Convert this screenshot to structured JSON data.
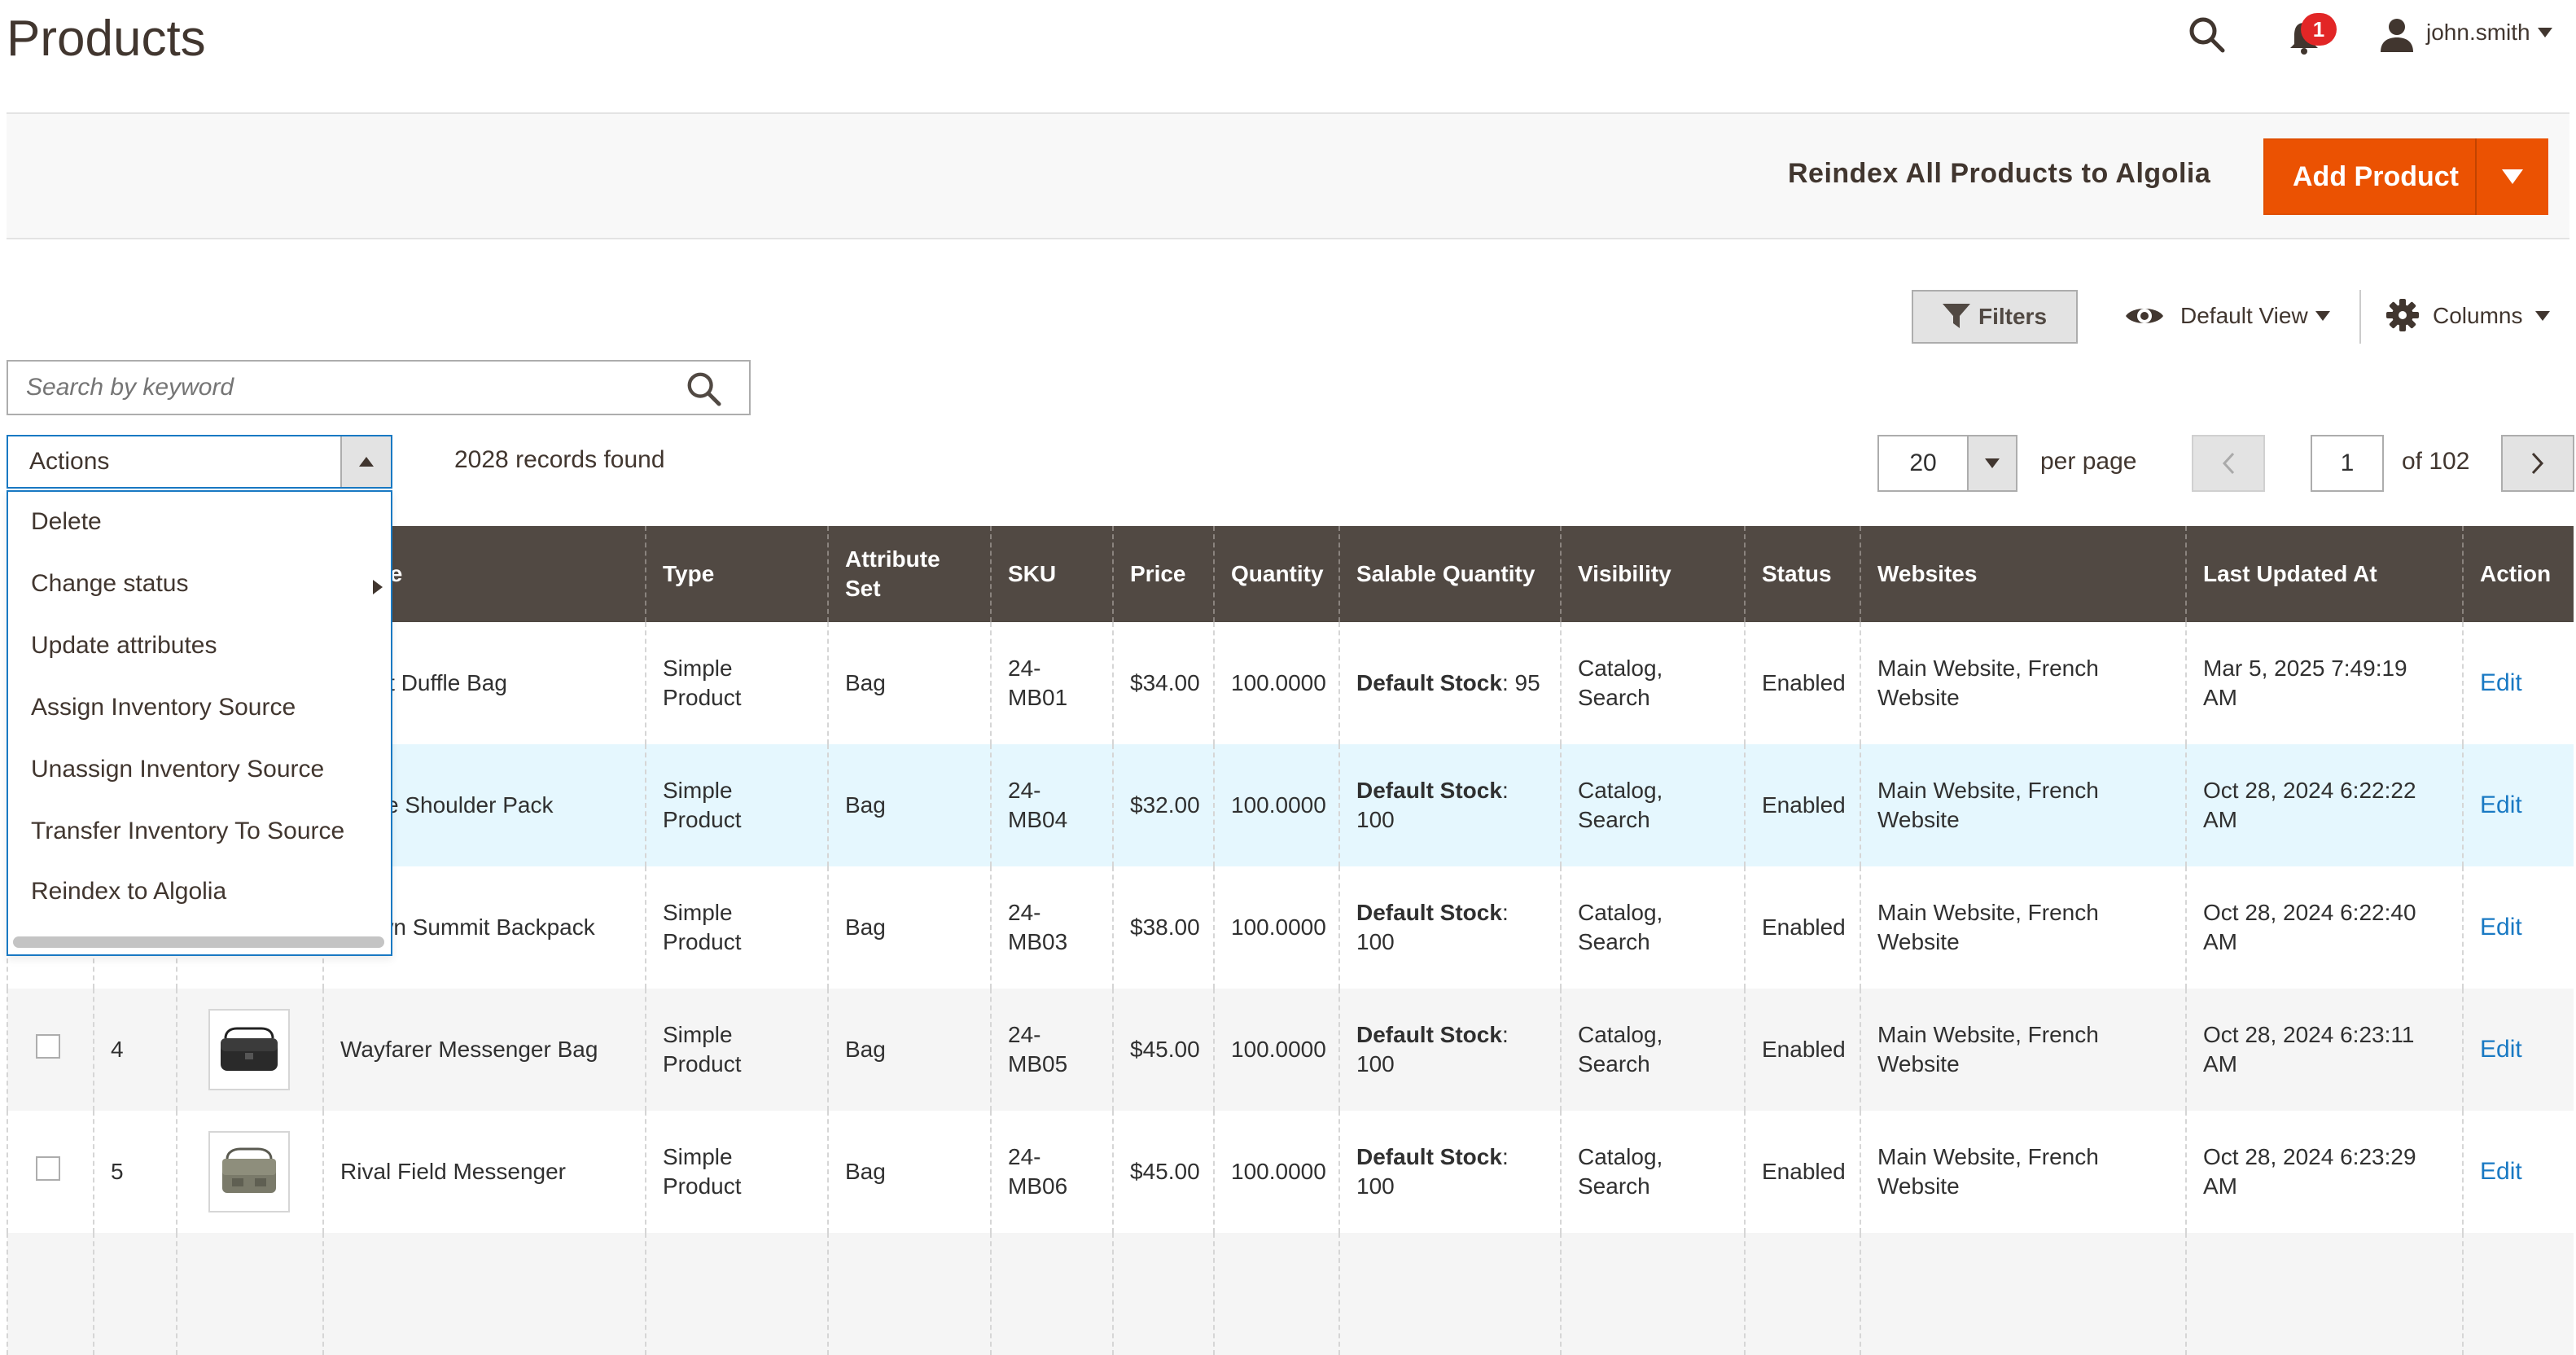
{
  "header": {
    "title": "Products",
    "notification_count": "1",
    "user": "john.smith"
  },
  "action_bar": {
    "reindex_label": "Reindex All Products to Algolia",
    "add_product_label": "Add Product"
  },
  "controls": {
    "filters_label": "Filters",
    "view_label": "Default View",
    "columns_label": "Columns",
    "search_placeholder": "Search by keyword",
    "actions_label": "Actions",
    "records_found": "2028 records found",
    "per_page_value": "20",
    "per_page_label": "per page",
    "current_page": "1",
    "page_total": "of 102"
  },
  "actions_menu": {
    "items": [
      "Delete",
      "Change status",
      "Update attributes",
      "Assign Inventory Source",
      "Unassign Inventory Source",
      "Transfer Inventory To Source",
      "Reindex to Algolia"
    ]
  },
  "table": {
    "headers": {
      "name": "Name",
      "type": "Type",
      "attribute_set_1": "Attribute",
      "attribute_set_2": "Set",
      "sku": "SKU",
      "price": "Price",
      "quantity": "Quantity",
      "salable": "Salable Quantity",
      "visibility": "Visibility",
      "status": "Status",
      "websites": "Websites",
      "updated": "Last Updated At",
      "action": "Action"
    },
    "rows": [
      {
        "id": "",
        "name": "Joust Duffle Bag",
        "type_1": "Simple",
        "type_2": "Product",
        "attr": "Bag",
        "sku_1": "24-",
        "sku_2": "MB01",
        "price": "$34.00",
        "qty": "100.0000",
        "stock_label": "Default Stock",
        "stock_value": ": 95",
        "vis_1": "Catalog,",
        "vis_2": "Search",
        "status": "Enabled",
        "web_1": "Main Website, French",
        "web_2": "Website",
        "updated": "Mar 5, 2025 7:49:19 AM",
        "action": "Edit"
      },
      {
        "id": "",
        "name": "Strive Shoulder Pack",
        "type_1": "Simple",
        "type_2": "Product",
        "attr": "Bag",
        "sku_1": "24-",
        "sku_2": "MB04",
        "price": "$32.00",
        "qty": "100.0000",
        "stock_label": "Default Stock",
        "stock_value": ":",
        "stock_value_2": "100",
        "vis_1": "Catalog,",
        "vis_2": "Search",
        "status": "Enabled",
        "web_1": "Main Website, French",
        "web_2": "Website",
        "updated": "Oct 28, 2024 6:22:22 AM",
        "action": "Edit"
      },
      {
        "id": "",
        "name": "Crown Summit Backpack",
        "type_1": "Simple",
        "type_2": "Product",
        "attr": "Bag",
        "sku_1": "24-",
        "sku_2": "MB03",
        "price": "$38.00",
        "qty": "100.0000",
        "stock_label": "Default Stock",
        "stock_value": ":",
        "stock_value_2": "100",
        "vis_1": "Catalog,",
        "vis_2": "Search",
        "status": "Enabled",
        "web_1": "Main Website, French",
        "web_2": "Website",
        "updated": "Oct 28, 2024 6:22:40 AM",
        "action": "Edit"
      },
      {
        "id": "4",
        "name": "Wayfarer Messenger Bag",
        "type_1": "Simple",
        "type_2": "Product",
        "attr": "Bag",
        "sku_1": "24-",
        "sku_2": "MB05",
        "price": "$45.00",
        "qty": "100.0000",
        "stock_label": "Default Stock",
        "stock_value": ":",
        "stock_value_2": "100",
        "vis_1": "Catalog,",
        "vis_2": "Search",
        "status": "Enabled",
        "web_1": "Main Website, French",
        "web_2": "Website",
        "updated": "Oct 28, 2024 6:23:11 AM",
        "action": "Edit"
      },
      {
        "id": "5",
        "name": "Rival Field Messenger",
        "type_1": "Simple",
        "type_2": "Product",
        "attr": "Bag",
        "sku_1": "24-",
        "sku_2": "MB06",
        "price": "$45.00",
        "qty": "100.0000",
        "stock_label": "Default Stock",
        "stock_value": ":",
        "stock_value_2": "100",
        "vis_1": "Catalog,",
        "vis_2": "Search",
        "status": "Enabled",
        "web_1": "Main Website, French",
        "web_2": "Website",
        "updated": "Oct 28, 2024 6:23:29 AM",
        "action": "Edit"
      }
    ]
  },
  "colors": {
    "accent": "#eb5202",
    "header_bg": "#514943",
    "link": "#1979c3"
  }
}
